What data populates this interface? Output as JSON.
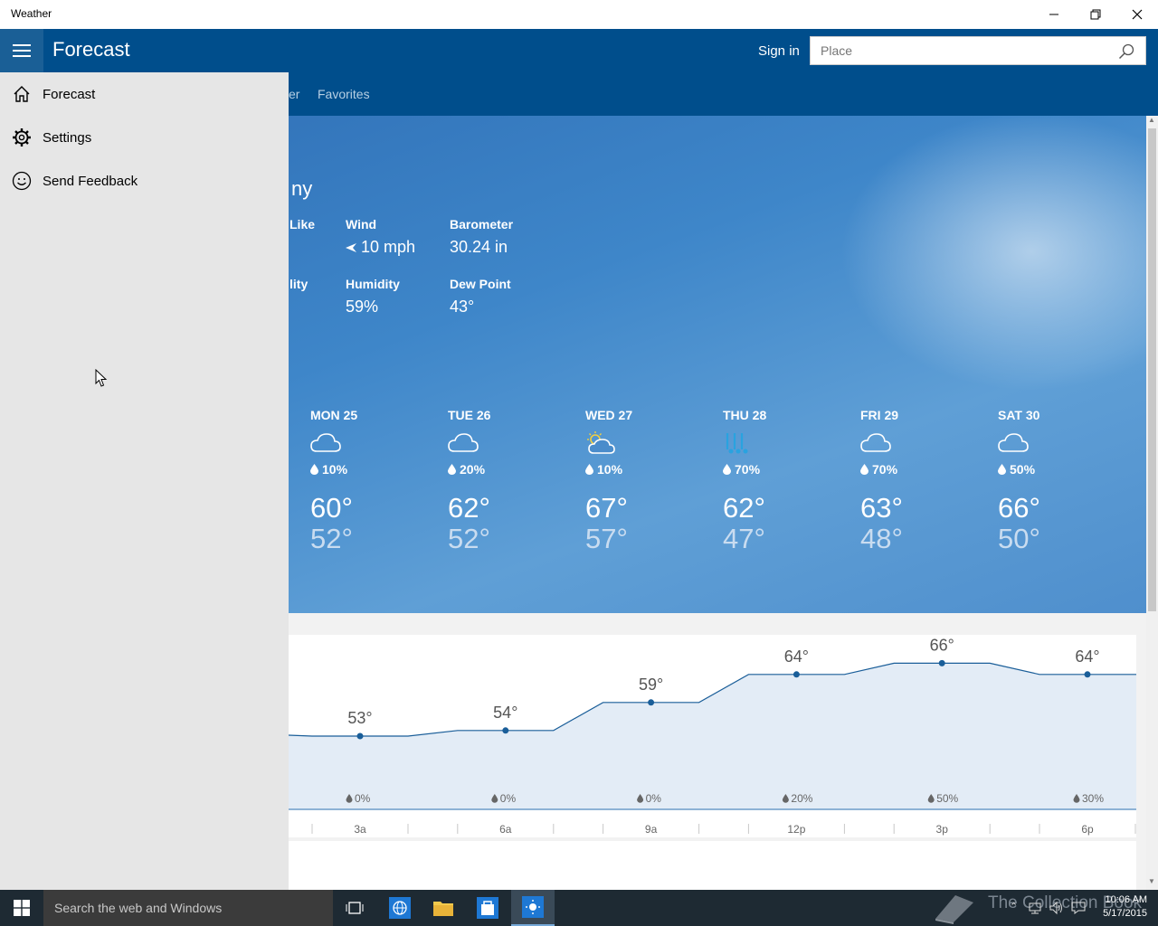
{
  "window": {
    "title": "Weather"
  },
  "header": {
    "title": "Forecast",
    "sign_in": "Sign in",
    "search_placeholder": "Place"
  },
  "subnav": {
    "tab_partial": "er",
    "favorites": "Favorites"
  },
  "current": {
    "condition_partial": "ny",
    "feels_like_partial": "Like",
    "visibility_partial": "lity",
    "wind_label": "Wind",
    "wind_value": "10 mph",
    "barometer_label": "Barometer",
    "barometer_value": "30.24 in",
    "humidity_label": "Humidity",
    "humidity_value": "59%",
    "dewpoint_label": "Dew Point",
    "dewpoint_value": "43°"
  },
  "daily": [
    {
      "day": "MON 25",
      "icon": "cloud-icon",
      "precip": "10%",
      "hi": "60°",
      "lo": "52°"
    },
    {
      "day": "TUE 26",
      "icon": "cloud-icon",
      "precip": "20%",
      "hi": "62°",
      "lo": "52°"
    },
    {
      "day": "WED 27",
      "icon": "partly-sunny-icon",
      "precip": "10%",
      "hi": "67°",
      "lo": "57°"
    },
    {
      "day": "THU 28",
      "icon": "rain-icon",
      "precip": "70%",
      "hi": "62°",
      "lo": "47°"
    },
    {
      "day": "FRI 29",
      "icon": "cloud-icon",
      "precip": "70%",
      "hi": "63°",
      "lo": "48°"
    },
    {
      "day": "SAT 30",
      "icon": "cloud-icon",
      "precip": "50%",
      "hi": "66°",
      "lo": "50°"
    }
  ],
  "hourly_labels": [
    {
      "temp": "53°",
      "precip": "0%",
      "time": "3a"
    },
    {
      "temp": "54°",
      "precip": "0%",
      "time": "6a"
    },
    {
      "temp": "59°",
      "precip": "0%",
      "time": "9a"
    },
    {
      "temp": "64°",
      "precip": "20%",
      "time": "12p"
    },
    {
      "temp": "66°",
      "precip": "50%",
      "time": "3p"
    },
    {
      "temp": "64°",
      "precip": "30%",
      "time": "6p"
    }
  ],
  "chart_data": {
    "type": "area",
    "x": [
      "3a",
      "6a",
      "9a",
      "12p",
      "3p",
      "6p"
    ],
    "series": [
      {
        "values": [
          53,
          54,
          59,
          64,
          66,
          64
        ]
      }
    ],
    "precip": [
      "0%",
      "0%",
      "0%",
      "20%",
      "50%",
      "30%"
    ]
  },
  "pane": {
    "items": [
      {
        "label": "Forecast",
        "icon": "home-icon"
      },
      {
        "label": "Settings",
        "icon": "gear-icon"
      },
      {
        "label": "Send Feedback",
        "icon": "smiley-icon"
      }
    ]
  },
  "taskbar": {
    "search_placeholder": "Search the web and Windows",
    "watermark": "The Collection Book",
    "time": "10:06 AM",
    "date": "5/17/2015"
  },
  "colors": {
    "header_bg": "#004e8c",
    "pane_bg": "#e6e6e6",
    "chart_line": "#1a5e99",
    "chart_fill": "#e3ecf6"
  }
}
